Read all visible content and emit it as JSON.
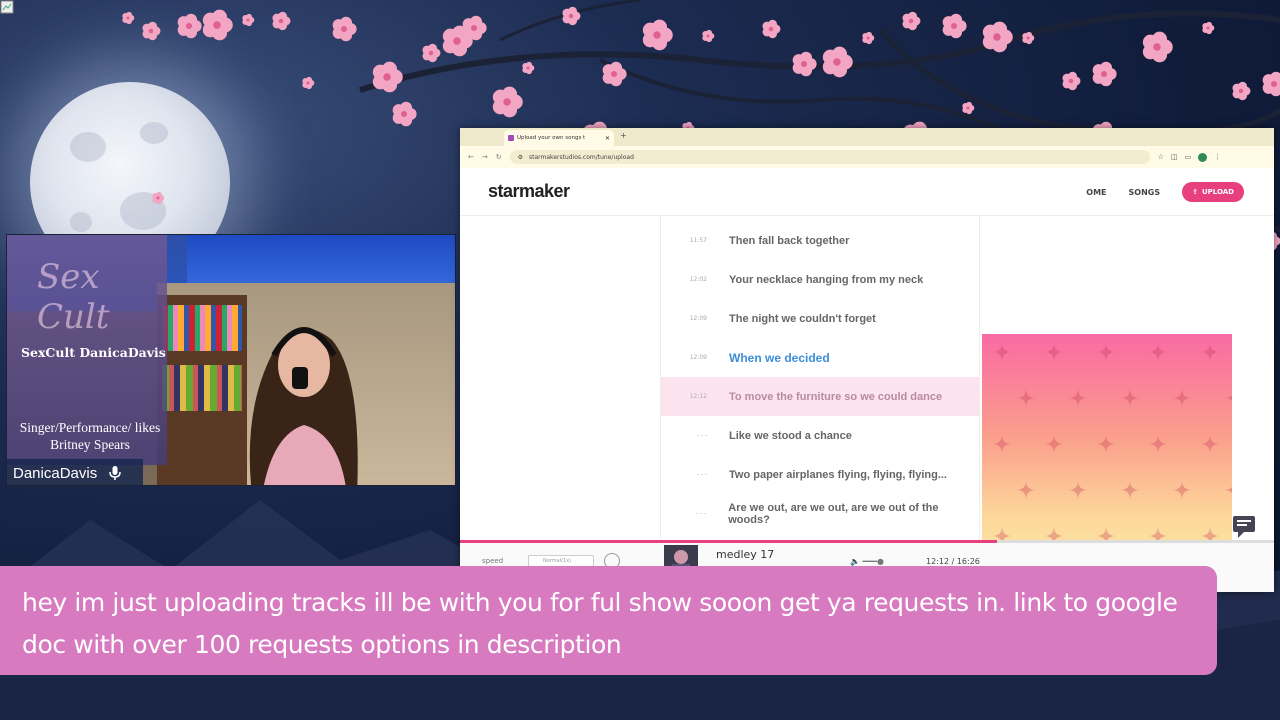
{
  "browser": {
    "tab_title": "Upload your own songs t",
    "url": "starmakerstudios.com/tune/upload"
  },
  "starmaker": {
    "logo": "starmaker",
    "nav": [
      "OME",
      "SONGS"
    ],
    "upload_label": "UPLOAD",
    "lyrics": [
      {
        "time": "11:57",
        "text": "Then fall back together",
        "state": "normal"
      },
      {
        "time": "12:02",
        "text": "Your necklace hanging from my neck",
        "state": "normal"
      },
      {
        "time": "12:09",
        "text": "The night we couldn't forget",
        "state": "normal"
      },
      {
        "time": "12:09",
        "text": "When we decided",
        "state": "active"
      },
      {
        "time": "12:12",
        "text": "To move the furniture so we could dance",
        "state": "highlight"
      },
      {
        "time": "- - -",
        "text": "Like we stood a chance",
        "state": "normal"
      },
      {
        "time": "- - -",
        "text": "Two paper airplanes flying, flying, flying...",
        "state": "normal"
      },
      {
        "time": "- - -",
        "text": "Are we out, are we out, are we out of the woods?",
        "state": "normal"
      }
    ],
    "player": {
      "speed_label": "speed",
      "speed_value": "Normal(1x)",
      "track_name": "medley 17",
      "time": "12:12 / 16:26",
      "progress": 0.66
    }
  },
  "webcam": {
    "banner_cursive": "Sex Cult",
    "banner_title": "SexCult DanicaDavis",
    "banner_sub": "Singer/Performance/ likes Britney Spears",
    "name": "DanicaDavis"
  },
  "chat": {
    "message": "hey im just uploading tracks ill be with you for ful show sooon get ya requests in. link to google doc with over 100 requests options in description"
  },
  "colors": {
    "chat_bg": "#d77ac0",
    "accent_pink": "#e8407e",
    "active_lyric": "#3b8fd8",
    "blossom": "#f3a6c4"
  }
}
